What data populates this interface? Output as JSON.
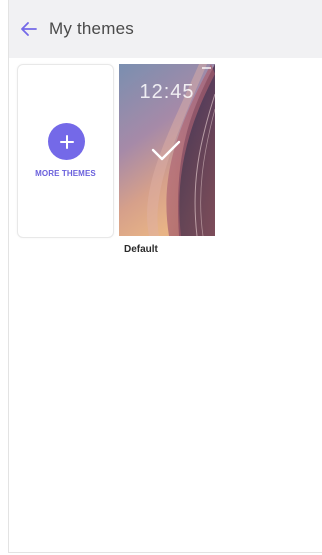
{
  "appbar": {
    "title": "My themes",
    "back_icon": "arrow-left-icon",
    "accent": "#7469e8"
  },
  "more_themes": {
    "label": "MORE THEMES",
    "icon": "plus-icon",
    "color": "#7469e8"
  },
  "themes": [
    {
      "name": "Default",
      "selected": true,
      "preview_time": "12:45",
      "check_icon": "checkmark-icon"
    }
  ]
}
